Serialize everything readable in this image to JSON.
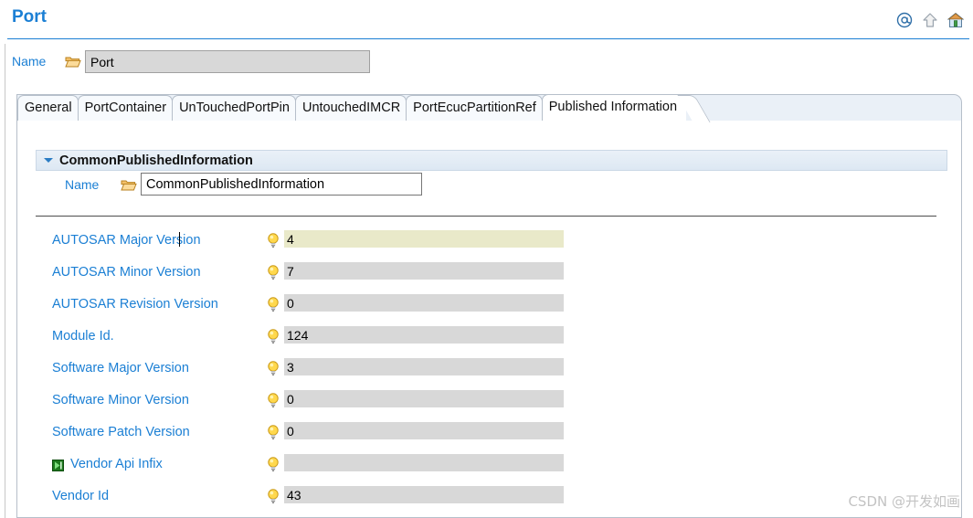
{
  "header": {
    "title": "Port",
    "icons": [
      {
        "name": "at-link-icon",
        "glyph": "@"
      },
      {
        "name": "up-arrow-icon",
        "glyph": "up"
      },
      {
        "name": "home-icon",
        "glyph": "home"
      }
    ],
    "accent_color": "#1b7fd4"
  },
  "top_name": {
    "label": "Name",
    "value": "Port",
    "placeholder": "",
    "icon": "open-folder-icon",
    "readonly": true
  },
  "tabs": [
    {
      "label": "General",
      "active": false
    },
    {
      "label": "PortContainer",
      "active": false
    },
    {
      "label": "UnTouchedPortPin",
      "active": false
    },
    {
      "label": "UntouchedIMCR",
      "active": false
    },
    {
      "label": "PortEcucPartitionRef",
      "active": false
    },
    {
      "label": "Published Information",
      "active": true
    }
  ],
  "section": {
    "title": "CommonPublishedInformation",
    "expanded": true,
    "twisty_icon": "chevron-down-icon",
    "name_label": "Name",
    "name_value": "CommonPublishedInformation",
    "name_icon": "open-folder-icon"
  },
  "properties": [
    {
      "label": "AUTOSAR Major Version",
      "value": "4",
      "icon": "lightbulb-icon",
      "focused": true,
      "caret_after": "AUTOSAR Major",
      "badge": null
    },
    {
      "label": "AUTOSAR Minor Version",
      "value": "7",
      "icon": "lightbulb-icon",
      "focused": false,
      "badge": null
    },
    {
      "label": "AUTOSAR Revision Version",
      "value": "0",
      "icon": "lightbulb-icon",
      "focused": false,
      "badge": null
    },
    {
      "label": "Module Id.",
      "value": "124",
      "icon": "lightbulb-icon",
      "focused": false,
      "badge": null
    },
    {
      "label": "Software Major Version",
      "value": "3",
      "icon": "lightbulb-icon",
      "focused": false,
      "badge": null
    },
    {
      "label": "Software Minor Version",
      "value": "0",
      "icon": "lightbulb-icon",
      "focused": false,
      "badge": null
    },
    {
      "label": "Software Patch Version",
      "value": "0",
      "icon": "lightbulb-icon",
      "focused": false,
      "badge": null
    },
    {
      "label": "Vendor Api Infix",
      "value": "",
      "icon": "lightbulb-icon",
      "focused": false,
      "badge": "optional-green-icon"
    },
    {
      "label": "Vendor Id",
      "value": "43",
      "icon": "lightbulb-icon",
      "focused": false,
      "badge": null
    }
  ],
  "colors": {
    "link_blue": "#1b7fd4",
    "field_gray": "#d8d8d8",
    "field_focus": "#e9e9c9",
    "section_bar": "#e4ecf4",
    "tabstrip": "#eaf0f7"
  },
  "watermark": "CSDN @开发如画"
}
